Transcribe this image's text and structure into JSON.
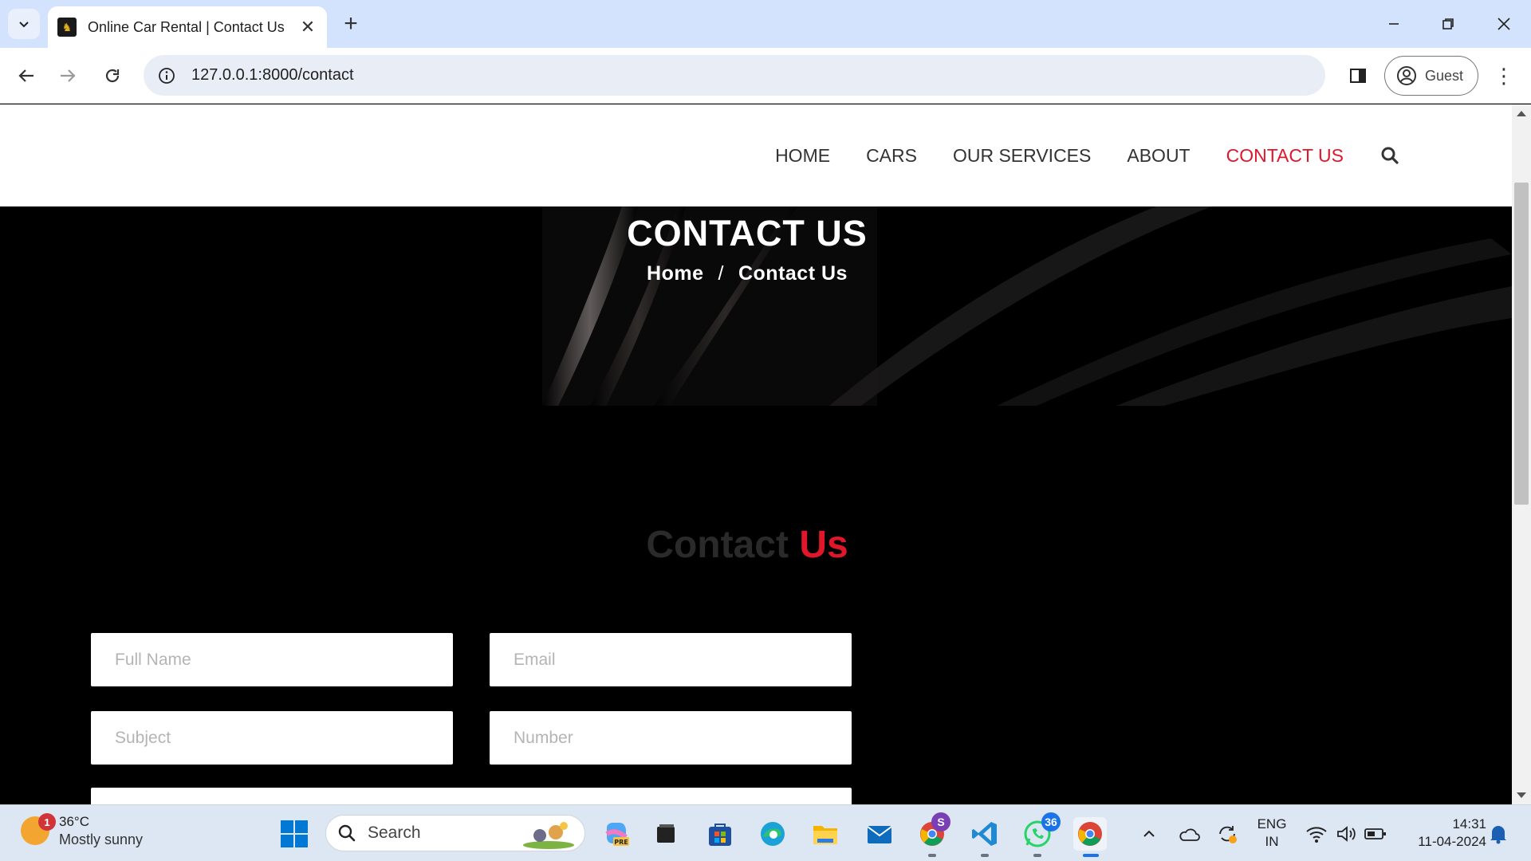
{
  "browser": {
    "tab_title": "Online Car Rental | Contact Us",
    "url": "127.0.0.1:8000/contact",
    "profile_label": "Guest"
  },
  "site": {
    "nav": [
      {
        "label": "HOME",
        "active": false
      },
      {
        "label": "CARS",
        "active": false
      },
      {
        "label": "OUR SERVICES",
        "active": false
      },
      {
        "label": "ABOUT",
        "active": false
      },
      {
        "label": "CONTACT US",
        "active": true
      }
    ],
    "hero": {
      "title": "CONTACT US",
      "breadcrumb_home": "Home",
      "breadcrumb_sep": "/",
      "breadcrumb_current": "Contact Us"
    },
    "section_title_part1": "Contact",
    "section_title_part2": "Us",
    "form": {
      "full_name_placeholder": "Full Name",
      "email_placeholder": "Email",
      "subject_placeholder": "Subject",
      "number_placeholder": "Number"
    },
    "colors": {
      "accent": "#e0162b"
    }
  },
  "taskbar": {
    "weather_temp": "36°C",
    "weather_desc": "Mostly sunny",
    "weather_badge": "1",
    "search_label": "Search",
    "chrome_badge": "S",
    "whatsapp_badge": "36",
    "lang_line1": "ENG",
    "lang_line2": "IN",
    "time": "14:31",
    "date": "11-04-2024"
  }
}
